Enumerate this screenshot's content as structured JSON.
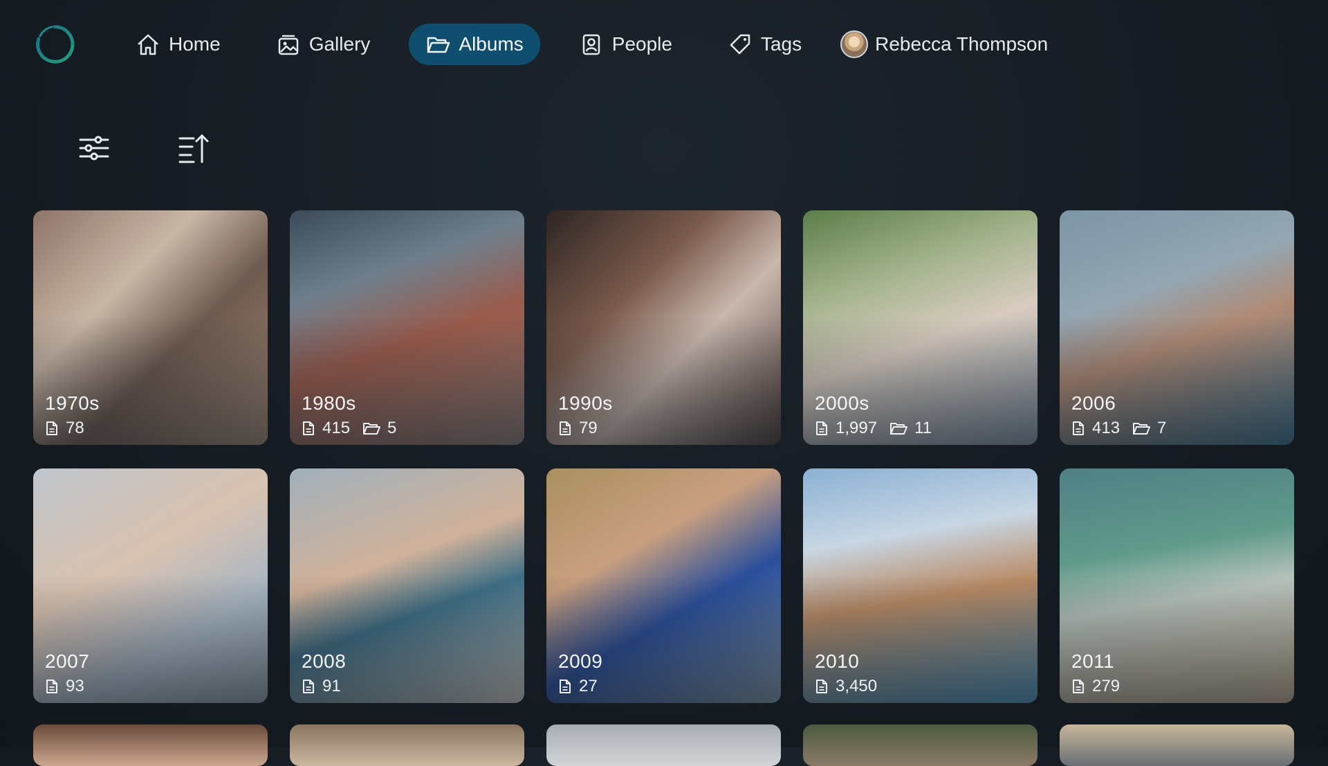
{
  "nav": {
    "items": [
      {
        "label": "Home",
        "icon": "home-icon",
        "active": false
      },
      {
        "label": "Gallery",
        "icon": "gallery-icon",
        "active": false
      },
      {
        "label": "Albums",
        "icon": "folder-open-icon",
        "active": true
      },
      {
        "label": "People",
        "icon": "person-icon",
        "active": false
      },
      {
        "label": "Tags",
        "icon": "tag-icon",
        "active": false
      }
    ],
    "user": {
      "name": "Rebecca Thompson"
    }
  },
  "toolbar": {
    "filter_icon": "sliders-icon",
    "sort_icon": "sort-ascending-icon"
  },
  "albums": [
    {
      "title": "1970s",
      "count": "78",
      "sub": "",
      "bg": "linear-gradient(135deg,#8d7468 0%,#c8b6a6 35%,#6e5a4f 60%,#a08774 100%)"
    },
    {
      "title": "1980s",
      "count": "415",
      "sub": "5",
      "bg": "linear-gradient(160deg,#3b4a5a 0%,#6f7f8c 30%,#9b5b4b 55%,#8a7a74 100%)"
    },
    {
      "title": "1990s",
      "count": "79",
      "sub": "",
      "bg": "linear-gradient(135deg,#2e2523 0%,#7a5a4c 35%,#c9b7ad 60%,#4a3a35 100%)"
    },
    {
      "title": "2000s",
      "count": "1,997",
      "sub": "11",
      "bg": "linear-gradient(160deg,#5c7d4a 0%,#a3b38c 30%,#d8cbbf 55%,#7e8fa0 100%)"
    },
    {
      "title": "2006",
      "count": "413",
      "sub": "7",
      "bg": "linear-gradient(160deg,#7d95a5 0%,#93a6b2 35%,#b08a74 55%,#3c6f8a 100%)"
    },
    {
      "title": "2007",
      "count": "93",
      "sub": "",
      "bg": "linear-gradient(150deg,#bfc6cc 0%,#d9c2b0 40%,#a7b6c4 70%,#8b97a1 100%)"
    },
    {
      "title": "2008",
      "count": "91",
      "sub": "",
      "bg": "linear-gradient(160deg,#9fb0bb 0%,#d1b29a 40%,#3e6f86 60%,#c9c6c0 100%)"
    },
    {
      "title": "2009",
      "count": "27",
      "sub": "",
      "bg": "linear-gradient(150deg,#a9905f 0%,#c99f7f 35%,#2a4f9b 60%,#7f93a4 100%)"
    },
    {
      "title": "2010",
      "count": "3,450",
      "sub": "",
      "bg": "linear-gradient(170deg,#8bb1d3 0%,#c7d6e4 30%,#b98a63 55%,#4a8fb8 100%)"
    },
    {
      "title": "2011",
      "count": "279",
      "sub": "",
      "bg": "linear-gradient(170deg,#4f7f86 0%,#5f9a8a 35%,#b9c4bd 55%,#b8a58c 100%)"
    }
  ],
  "partial_row_bgs": [
    "linear-gradient(180deg,#6b4a3b,#caa78e)",
    "linear-gradient(180deg,#8a7660,#c9b7a0)",
    "linear-gradient(180deg,#a8adb2,#d1d5d8)",
    "linear-gradient(180deg,#4c5a3f,#8b7a66)",
    "linear-gradient(180deg,#c8b69a,#6a6f74)"
  ]
}
